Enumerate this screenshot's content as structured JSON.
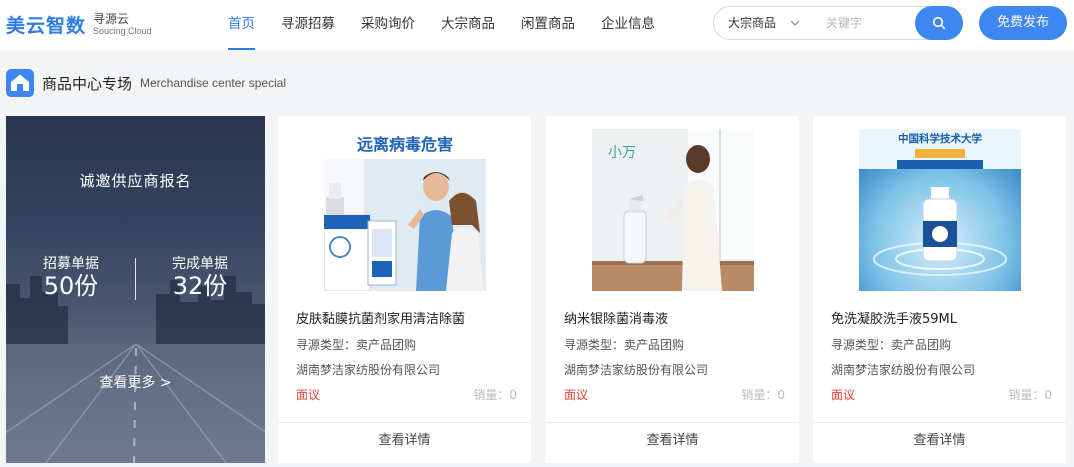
{
  "header": {
    "logo_main": "美云智数",
    "logo_sub_cn": "寻源云",
    "logo_sub_en": "Soucing Cloud",
    "nav": [
      {
        "label": "首页",
        "active": true
      },
      {
        "label": "寻源招募",
        "active": false
      },
      {
        "label": "采购询价",
        "active": false
      },
      {
        "label": "大宗商品",
        "active": false
      },
      {
        "label": "闲置商品",
        "active": false
      },
      {
        "label": "企业信息",
        "active": false
      }
    ],
    "search": {
      "category": "大宗商品",
      "placeholder": "关键字",
      "value": ""
    },
    "publish_label": "免费发布"
  },
  "section": {
    "title_cn": "商品中心专场",
    "title_en": "Merchandise center special"
  },
  "banner": {
    "heading": "诚邀供应商报名",
    "stats": [
      {
        "label": "招募单据",
        "value": "50份"
      },
      {
        "label": "完成单据",
        "value": "32份"
      }
    ],
    "more_label": "查看更多 >"
  },
  "products": [
    {
      "image_text": "远离病毒危害",
      "name": "皮肤黏膜抗菌剂家用清洁除菌",
      "type": "寻源类型：卖产品团购",
      "company": "湖南梦洁家纺股份有限公司",
      "price": "面议",
      "sales": "销量：0",
      "detail_label": "查看详情"
    },
    {
      "image_text": "小万",
      "name": "纳米银除菌消毒液",
      "type": "寻源类型：卖产品团购",
      "company": "湖南梦洁家纺股份有限公司",
      "price": "面议",
      "sales": "销量：0",
      "detail_label": "查看详情"
    },
    {
      "image_text": "中国科学技术大学",
      "name": "免洗凝胶洗手液59ML",
      "type": "寻源类型：卖产品团购",
      "company": "湖南梦洁家纺股份有限公司",
      "price": "面议",
      "sales": "销量：0",
      "detail_label": "查看详情"
    }
  ],
  "colors": {
    "accent": "#3e86f0",
    "price": "#e1453a",
    "background": "#f3f4f6"
  },
  "icons": {
    "search": "search-icon",
    "chevron": "chevron-down-icon",
    "section": "home-badge-icon"
  }
}
